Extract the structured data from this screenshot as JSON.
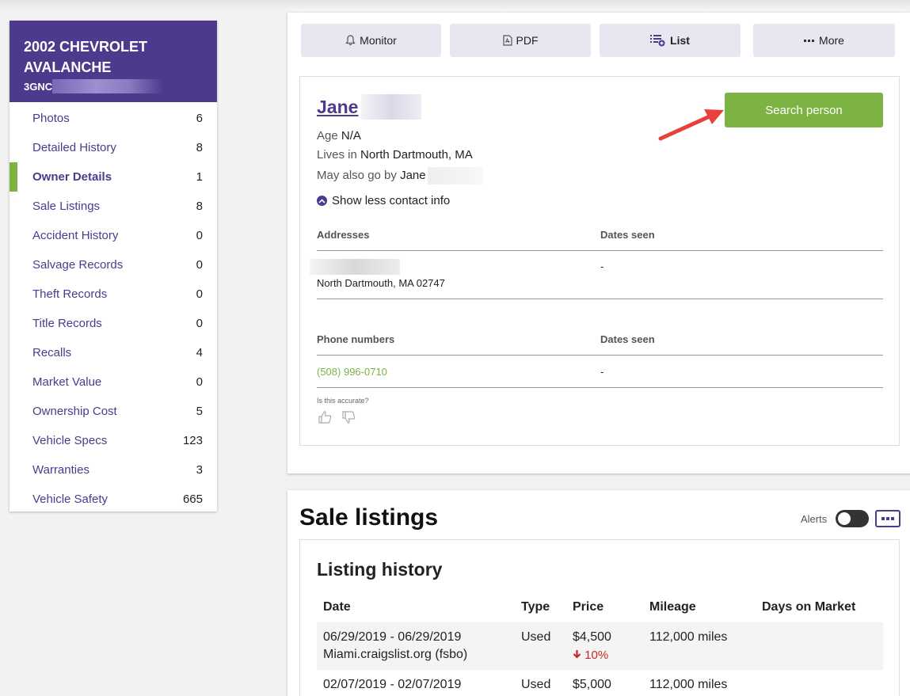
{
  "vehicle": {
    "title_line1": "2002 CHEVROLET",
    "title_line2": "AVALANCHE",
    "vin_prefix": "3GNC"
  },
  "sidebar": {
    "items": [
      {
        "label": "Photos",
        "count": "6"
      },
      {
        "label": "Detailed History",
        "count": "8"
      },
      {
        "label": "Owner Details",
        "count": "1"
      },
      {
        "label": "Sale Listings",
        "count": "8"
      },
      {
        "label": "Accident History",
        "count": "0"
      },
      {
        "label": "Salvage Records",
        "count": "0"
      },
      {
        "label": "Theft Records",
        "count": "0"
      },
      {
        "label": "Title Records",
        "count": "0"
      },
      {
        "label": "Recalls",
        "count": "4"
      },
      {
        "label": "Market Value",
        "count": "0"
      },
      {
        "label": "Ownership Cost",
        "count": "5"
      },
      {
        "label": "Vehicle Specs",
        "count": "123"
      },
      {
        "label": "Warranties",
        "count": "3"
      },
      {
        "label": "Vehicle Safety",
        "count": "665"
      }
    ],
    "active_index": 2
  },
  "toolbar": {
    "monitor": "Monitor",
    "pdf": "PDF",
    "list": "List",
    "more": "More"
  },
  "person": {
    "first_name": "Jane",
    "age_label": "Age",
    "age_value": "N/A",
    "lives_label": "Lives in",
    "lives_value": "North Dartmouth, MA",
    "aka_label": "May also go by",
    "aka_value": "Jane",
    "toggle_label": "Show less contact info",
    "search_button": "Search person",
    "addresses_header": "Addresses",
    "dates_seen_header": "Dates seen",
    "address_line2": "North Dartmouth, MA 02747",
    "address_dates": "-",
    "phones_header": "Phone numbers",
    "phone_dates_header": "Dates seen",
    "phone": "(508) 996-0710",
    "phone_dates": "-",
    "accurate_prompt": "Is this accurate?"
  },
  "sale_listings": {
    "title": "Sale listings",
    "alerts_label": "Alerts",
    "history_title": "Listing history",
    "columns": [
      "Date",
      "Type",
      "Price",
      "Mileage",
      "Days on Market"
    ],
    "rows": [
      {
        "date": "06/29/2019 - 06/29/2019",
        "source": "Miami.craigslist.org (fsbo)",
        "type": "Used",
        "price": "$4,500",
        "change": "10%",
        "mileage": "112,000 miles",
        "days": ""
      },
      {
        "date": "02/07/2019 - 02/07/2019",
        "source": "",
        "type": "Used",
        "price": "$5,000",
        "change": "",
        "mileage": "112,000 miles",
        "days": ""
      }
    ]
  },
  "colors": {
    "brand_purple": "#4d3a8c",
    "accent_green": "#7cb342",
    "arrow_red": "#e8413c",
    "price_drop_red": "#c62828"
  }
}
